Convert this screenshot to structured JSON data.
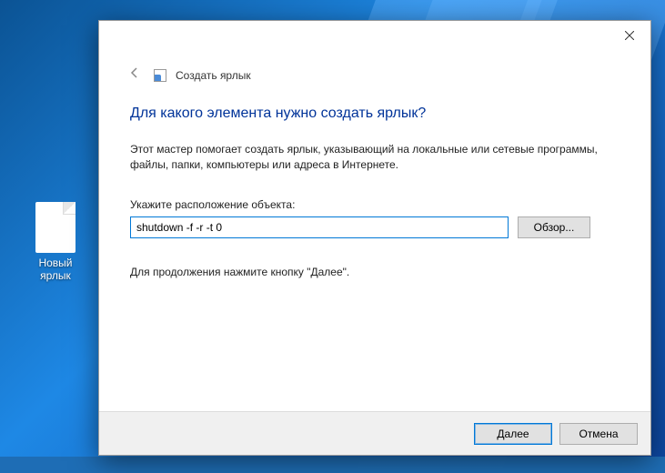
{
  "desktop": {
    "shortcut_label": "Новый ярлык"
  },
  "dialog": {
    "breadcrumb": "Создать ярлык",
    "heading": "Для какого элемента нужно создать ярлык?",
    "description": "Этот мастер помогает создать ярлык, указывающий на локальные или сетевые программы, файлы, папки, компьютеры или адреса в Интернете.",
    "field_label": "Укажите расположение объекта:",
    "location_value": "shutdown -f -r -t 0",
    "browse_label": "Обзор...",
    "continue_text": "Для продолжения нажмите кнопку \"Далее\".",
    "next_label": "Далее",
    "cancel_label": "Отмена"
  }
}
